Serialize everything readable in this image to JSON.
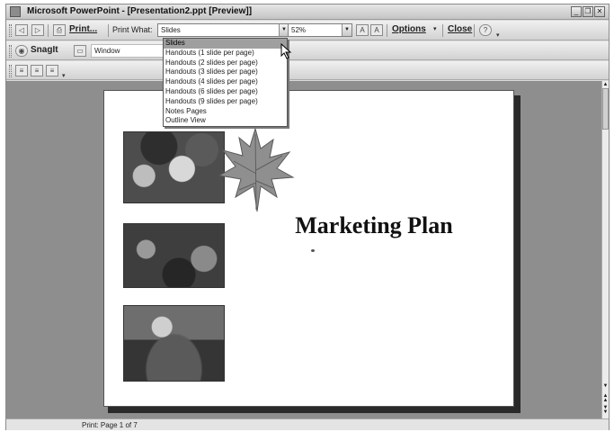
{
  "window": {
    "title": "Microsoft PowerPoint - [Presentation2.ppt [Preview]]",
    "controls": [
      "minimize-icon",
      "restore-icon",
      "close-icon"
    ]
  },
  "toolbar1": {
    "print_label": "Print...",
    "print_what_label": "Print What:",
    "print_what_value": "Slides",
    "zoom_value": "52%",
    "options_label": "Options",
    "close_label": "Close"
  },
  "toolbar2": {
    "snagit_label": "SnagIt",
    "window_value": "Window"
  },
  "print_what_options": [
    "Slides",
    "Handouts (1 slide per page)",
    "Handouts (2 slides per page)",
    "Handouts (3 slides per page)",
    "Handouts (4 slides per page)",
    "Handouts (6 slides per page)",
    "Handouts (9 slides per page)",
    "Notes Pages",
    "Outline View"
  ],
  "slide": {
    "title": "Marketing Plan"
  },
  "status": {
    "page_text": "Print: Page 1 of 7"
  }
}
